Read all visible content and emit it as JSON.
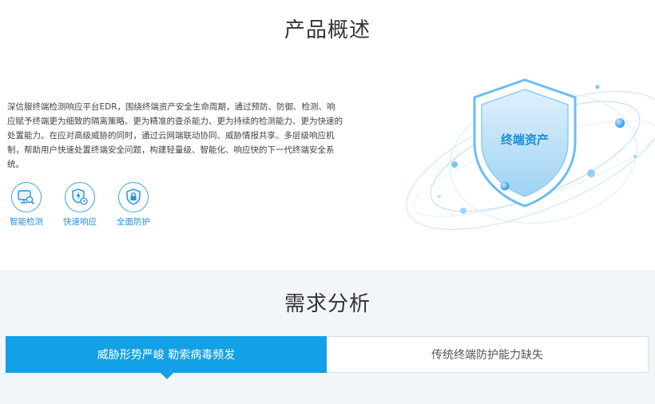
{
  "overview": {
    "title": "产品概述",
    "description": "深信服终端检测响应平台EDR，围绕终端资产安全生命周期，通过预防、防御、检测、响应赋予终端更为细致的隔离策略、更为精准的查杀能力、更为持续的检测能力、更为快速的处置能力。在应对高级威胁的同时，通过云网端联动协同、威胁情报共享、多层级响应机制，帮助用户快速处置终端安全问题，构建轻量级、智能化、响应快的下一代终端安全系统。",
    "features": [
      {
        "label": "智能检测",
        "icon": "monitor-search-icon"
      },
      {
        "label": "快速响应",
        "icon": "shield-lightning-icon"
      },
      {
        "label": "全面防护",
        "icon": "shield-lock-icon"
      }
    ],
    "hero_label": "终端资产",
    "colors": {
      "accent": "#12a0e7",
      "feature_text": "#2a8fd8"
    }
  },
  "analysis": {
    "title": "需求分析",
    "tabs": [
      {
        "label": "威胁形势严峻 勒索病毒频发",
        "active": true
      },
      {
        "label": "传统终端防护能力缺失",
        "active": false
      }
    ]
  }
}
